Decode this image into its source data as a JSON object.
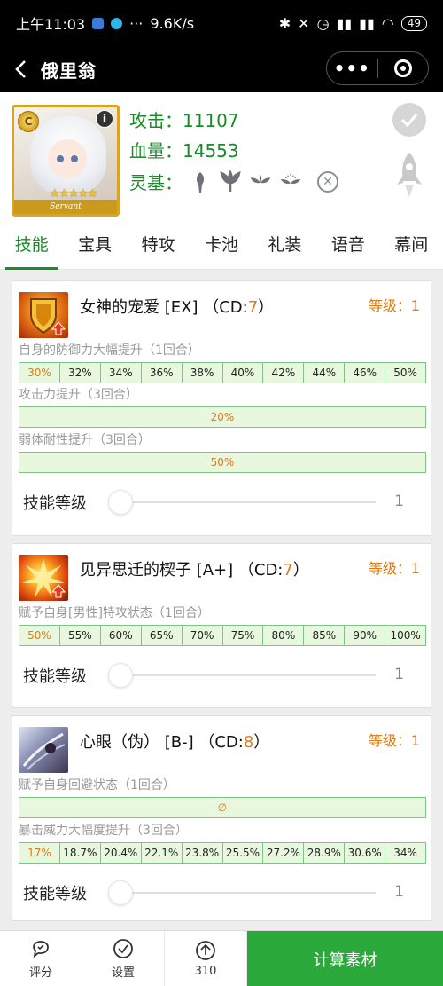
{
  "status_bar": {
    "time": "上午11:03",
    "dots": "···",
    "speed": "9.6K/s",
    "battery": "49"
  },
  "nav": {
    "title": "俄里翁",
    "more": "•••"
  },
  "servant": {
    "portrait_label": "Servant",
    "stars": "★★★★★",
    "atk_label": "攻击：",
    "atk": "11107",
    "hp_label": "血量：",
    "hp": "14553",
    "ling_label": "灵基：",
    "class_badge": "C"
  },
  "tabs": [
    "技能",
    "宝具",
    "特攻",
    "卡池",
    "礼装",
    "语音",
    "幕间"
  ],
  "skills": [
    {
      "name_prefix": "女神的宠爱 [EX] （CD:",
      "cd": "7",
      "name_suffix": "）",
      "level": "等级：1",
      "effects": [
        {
          "label": "自身的防御力大幅提升（1回合）",
          "values": [
            "30%",
            "32%",
            "34%",
            "36%",
            "38%",
            "40%",
            "42%",
            "44%",
            "46%",
            "50%"
          ]
        },
        {
          "label": "攻击力提升（3回合）",
          "values": [
            "20%"
          ]
        },
        {
          "label": "弱体耐性提升（3回合）",
          "values": [
            "50%"
          ]
        }
      ],
      "slider_label": "技能等级",
      "slider_value": "1"
    },
    {
      "name_prefix": "见异思迁的楔子 [A+] （CD:",
      "cd": "7",
      "name_suffix": "）",
      "level": "等级：1",
      "effects": [
        {
          "label": "赋予自身[男性]特攻状态（1回合）",
          "values": [
            "50%",
            "55%",
            "60%",
            "65%",
            "70%",
            "75%",
            "80%",
            "85%",
            "90%",
            "100%"
          ]
        }
      ],
      "slider_label": "技能等级",
      "slider_value": "1"
    },
    {
      "name_prefix": "心眼（伪） [B-] （CD:",
      "cd": "8",
      "name_suffix": "）",
      "level": "等级：1",
      "effects": [
        {
          "label": "赋予自身回避状态（1回合）",
          "values": [
            "∅"
          ]
        },
        {
          "label": "暴击威力大幅度提升（3回合）",
          "values": [
            "17%",
            "18.7%",
            "20.4%",
            "22.1%",
            "23.8%",
            "25.5%",
            "27.2%",
            "28.9%",
            "30.6%",
            "34%"
          ]
        }
      ],
      "slider_label": "技能等级",
      "slider_value": "1"
    }
  ],
  "bottom": {
    "rate": "评分",
    "settings": "设置",
    "count": "310",
    "calc": "计算素材"
  },
  "colors": {
    "accent_green": "#1a8a2a",
    "button_green": "#2aa83a",
    "orange": "#e07a14"
  }
}
